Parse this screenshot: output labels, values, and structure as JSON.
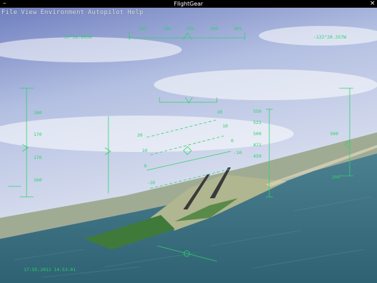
{
  "window": {
    "title": "FlightGear",
    "close_glyph": "×",
    "minimize_glyph": "–"
  },
  "menu": {
    "items": [
      "File",
      "View",
      "Environment",
      "Autopilot",
      "Help"
    ]
  },
  "hud": {
    "latitude": "37°36.605N",
    "longitude": "-122°20.357W",
    "heading_scale": [
      "285",
      "290",
      "295",
      "300",
      "305"
    ],
    "airspeed_scale": [
      "180",
      "170",
      "170",
      "160"
    ],
    "altitude_scale": [
      "550",
      "521",
      "500",
      "471",
      "450"
    ],
    "pitch_ladder_left": [
      "20",
      "10",
      "0",
      "-10"
    ],
    "pitch_ladder_right": [
      "10",
      "10",
      "0",
      "-10"
    ],
    "right_readout_top": "500",
    "right_readout_bottom": "200",
    "timestamp": "17:55:2012 14:53:01",
    "color": "#2bd36a"
  },
  "colors": {
    "sky_top": "#6f7fc0",
    "sky_bottom": "#e8ecf4",
    "sea": "#3b6f7e",
    "land": "#9fae8a",
    "runway": "#4a4a4a"
  }
}
